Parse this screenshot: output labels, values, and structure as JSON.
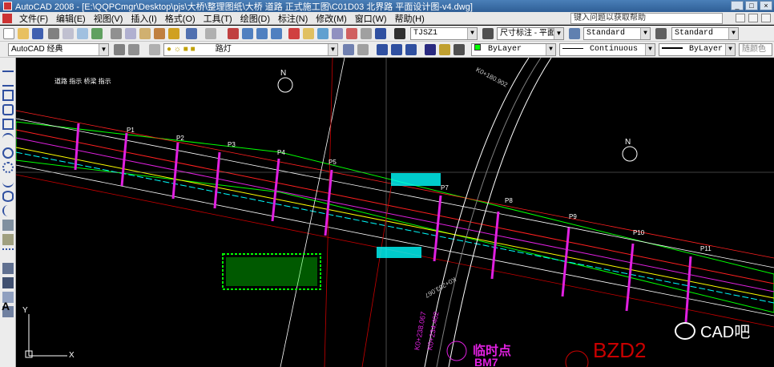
{
  "window": {
    "title": "AutoCAD 2008 - [E:\\QQPCmgr\\Desktop\\pjs\\大桥\\整理图纸\\大桥 道路 正式施工图\\C01D03 北界路 平面设计图-v4.dwg]"
  },
  "menu": {
    "items": [
      "文件(F)",
      "编辑(E)",
      "视图(V)",
      "插入(I)",
      "格式(O)",
      "工具(T)",
      "绘图(D)",
      "标注(N)",
      "修改(M)",
      "窗口(W)",
      "帮助(H)"
    ],
    "help_placeholder": "键入问题以获取帮助"
  },
  "toolbar1": {
    "text_style": "TJSZ1",
    "dim_style": "尺寸标注 - 平面",
    "table_style": "Standard",
    "multileader_style": "Standard"
  },
  "toolbar2": {
    "workspace": "AutoCAD 经典",
    "layer": "路灯",
    "color": "ByLayer",
    "linetype": "Continuous",
    "lineweight": "ByLayer",
    "plot_style": "随颜色"
  },
  "drawing": {
    "piers": [
      "P1",
      "P2",
      "P3",
      "P4",
      "P5",
      "P7",
      "P8",
      "P9",
      "P10",
      "P11"
    ],
    "chainage_top": "K0+180.902",
    "chainage_mid": "K0+203.067",
    "chainage_bottom_1": "K0+238.067",
    "chainage_bottom_2": "K0+234.402",
    "temp_point": "临时点",
    "temp_point_code": "BM7",
    "benchmark": "BZD2",
    "north": "N",
    "ucs_x": "X",
    "ucs_y": "Y",
    "top_left_labels": "道路 指示   桥梁 指示"
  },
  "watermark": {
    "text": "CAD吧"
  },
  "colors": {
    "magenta": "#e020e0",
    "cyan": "#00ffff",
    "green": "#00ff00",
    "red": "#ff2020",
    "yellow": "#ffff00"
  }
}
